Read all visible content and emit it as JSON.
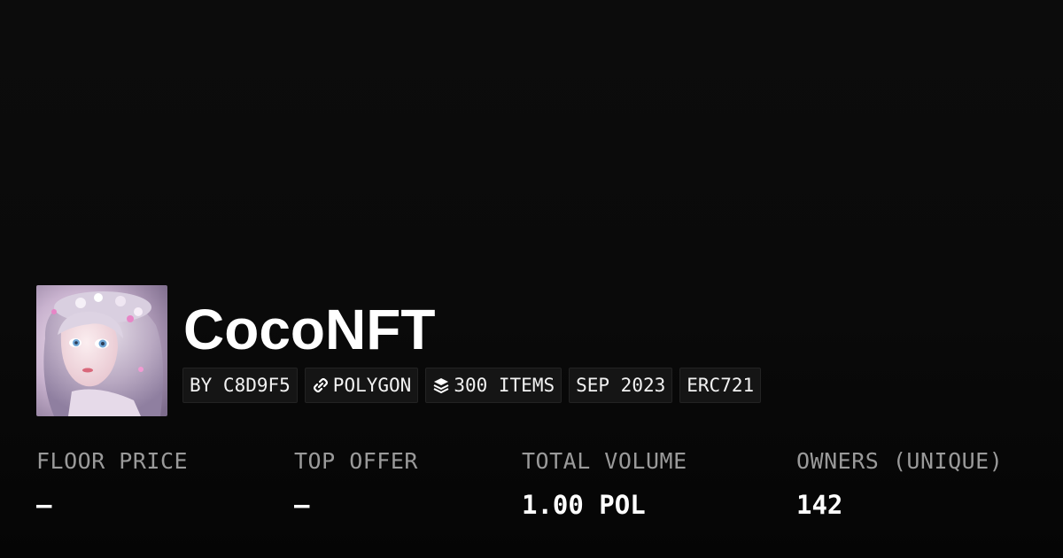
{
  "collection": {
    "name": "CocoNFT",
    "avatar_description_icon": "collection-avatar-illustration"
  },
  "tags": [
    {
      "label": "BY C8D9F5",
      "icon": null
    },
    {
      "label": "POLYGON",
      "icon": "link-icon"
    },
    {
      "label": "300 ITEMS",
      "icon": "layers-icon"
    },
    {
      "label": "SEP 2023",
      "icon": null
    },
    {
      "label": "ERC721",
      "icon": null
    }
  ],
  "stats": [
    {
      "label": "FLOOR PRICE",
      "value": "–"
    },
    {
      "label": "TOP OFFER",
      "value": "–"
    },
    {
      "label": "TOTAL VOLUME",
      "value": "1.00 POL"
    },
    {
      "label": "OWNERS (UNIQUE)",
      "value": "142"
    }
  ],
  "colors": {
    "background": "#0b0b0b",
    "text_primary": "#ffffff",
    "text_muted": "#9a9a9a",
    "tag_background": "#151515"
  }
}
